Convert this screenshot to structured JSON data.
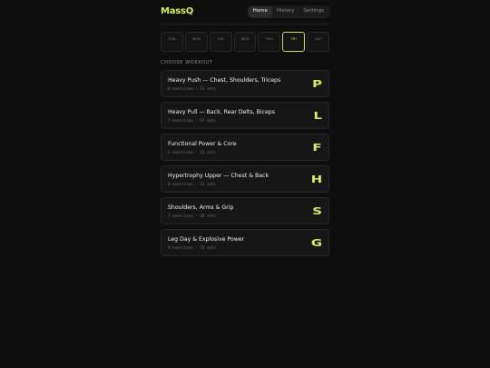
{
  "app": {
    "brand": "MassQ"
  },
  "nav": {
    "tabs": [
      "Home",
      "History",
      "Settings"
    ],
    "active": 0
  },
  "week": {
    "days": [
      "SUN",
      "MON",
      "TUE",
      "WED",
      "THU",
      "FRI",
      "SAT"
    ],
    "active": 5
  },
  "workouts": {
    "section_label": "CHOOSE WORKOUT",
    "items": [
      {
        "title": "Heavy Push — Chest, Shoulders, Triceps",
        "meta": "8 exercises · 31 sets",
        "letter": "P"
      },
      {
        "title": "Heavy Pull — Back, Rear Delts, Biceps",
        "meta": "7 exercises · 27 sets",
        "letter": "L"
      },
      {
        "title": "Functional Power & Core",
        "meta": "6 exercises · 21 sets",
        "letter": "F"
      },
      {
        "title": "Hypertrophy Upper — Chest & Back",
        "meta": "8 exercises · 31 sets",
        "letter": "H"
      },
      {
        "title": "Shoulders, Arms & Grip",
        "meta": "7 exercises · 28 sets",
        "letter": "S"
      },
      {
        "title": "Leg Day & Explosive Power",
        "meta": "9 exercises · 35 sets",
        "letter": "G"
      }
    ]
  },
  "colors": {
    "accent": "#d9f24a",
    "background": "#0e0e0e",
    "card": "#161616"
  }
}
